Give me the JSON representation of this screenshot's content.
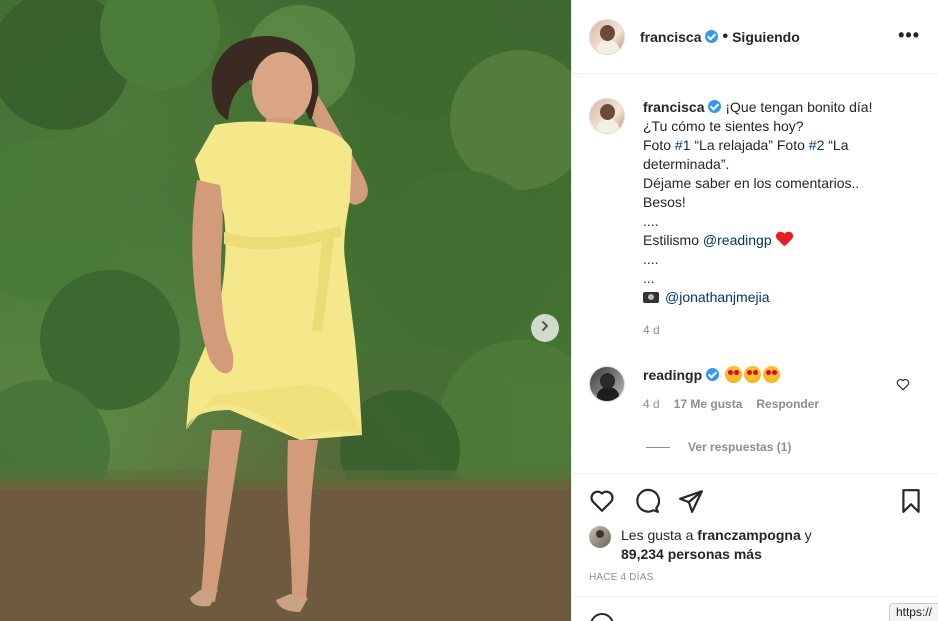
{
  "post": {
    "author": "francisca",
    "follow_status": "Siguiendo",
    "more_label": "•••",
    "caption": {
      "username": "francisca",
      "line1": "¡Que tengan bonito día!",
      "line2": "¿Tu cómo te sientes hoy?",
      "line3_pre": "Foto ",
      "tag1": "#1",
      "line3_mid": " “La relajada” Foto ",
      "tag2": "#2",
      "line3_post": " “La determinada”.",
      "line4": "Déjame saber en los comentarios..",
      "line5": "Besos!",
      "line6": "....",
      "styling_label": "Estilismo ",
      "styling_mention": "@readingp",
      "line8": "....",
      "line9": "...",
      "photo_mention": "@jonathanjmejia",
      "age": "4 d"
    },
    "comment": {
      "username": "readingp",
      "age": "4 d",
      "likes": "17 Me gusta",
      "reply_label": "Responder",
      "view_replies": "Ver respuestas (1)"
    },
    "liked_by": {
      "prefix": "Les gusta a ",
      "user": "franczampogna",
      "connector": " y",
      "count": "89,234 personas más"
    },
    "date": "HACE 4 DÍAS"
  },
  "status_bar": {
    "url": "https://"
  },
  "icons": {
    "verified": "verified-badge-icon",
    "like": "heart-icon",
    "comment": "comment-bubble-icon",
    "share": "paper-plane-icon",
    "save": "bookmark-icon",
    "next": "chevron-right-icon",
    "camera": "camera-emoji-icon",
    "heart_emoji": "red-heart-emoji",
    "star_eyes": "star-struck-emoji"
  },
  "colors": {
    "verified": "#3897f0",
    "link": "#00376b",
    "muted": "#8e8e8e",
    "dress": "#f5e88a"
  }
}
